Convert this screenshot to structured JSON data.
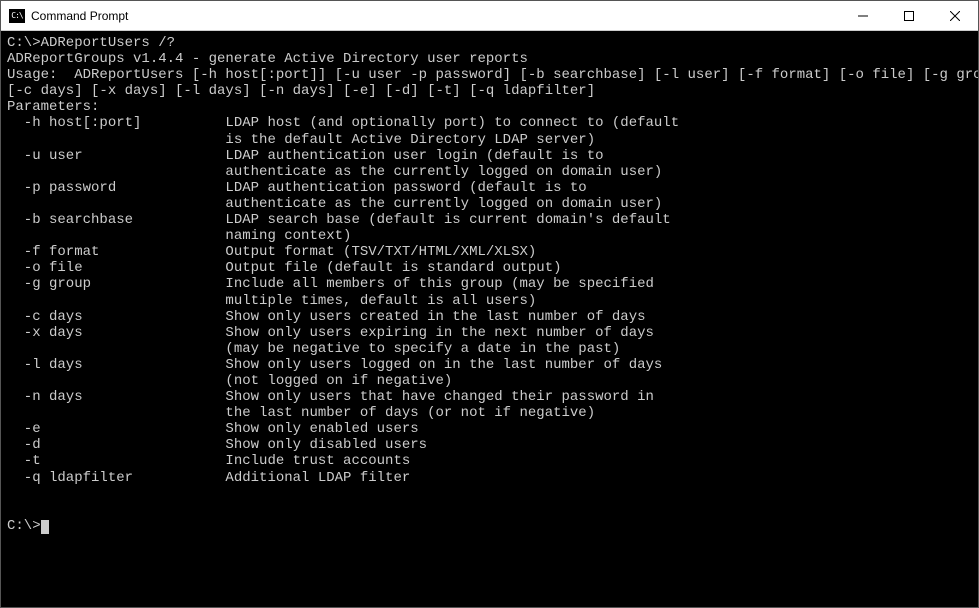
{
  "window": {
    "title": "Command Prompt",
    "icon_label": "C:\\"
  },
  "terminal": {
    "prompt": "C:\\>",
    "command": "ADReportUsers /?",
    "version_line": "ADReportGroups v1.4.4 - generate Active Directory user reports",
    "usage_lines": [
      "Usage:  ADReportUsers [-h host[:port]] [-u user -p password] [-b searchbase] [-l user] [-f format] [-o file] [-g group]",
      "[-c days] [-x days] [-l days] [-n days] [-e] [-d] [-t] [-q ldapfilter]"
    ],
    "parameters_header": "Parameters:",
    "parameters": [
      {
        "flag": "-h host[:port]",
        "desc": [
          "LDAP host (and optionally port) to connect to (default",
          "is the default Active Directory LDAP server)"
        ]
      },
      {
        "flag": "-u user",
        "desc": [
          "LDAP authentication user login (default is to",
          "authenticate as the currently logged on domain user)"
        ]
      },
      {
        "flag": "-p password",
        "desc": [
          "LDAP authentication password (default is to",
          "authenticate as the currently logged on domain user)"
        ]
      },
      {
        "flag": "-b searchbase",
        "desc": [
          "LDAP search base (default is current domain's default",
          "naming context)"
        ]
      },
      {
        "flag": "-f format",
        "desc": [
          "Output format (TSV/TXT/HTML/XML/XLSX)"
        ]
      },
      {
        "flag": "-o file",
        "desc": [
          "Output file (default is standard output)"
        ]
      },
      {
        "flag": "-g group",
        "desc": [
          "Include all members of this group (may be specified",
          "multiple times, default is all users)"
        ]
      },
      {
        "flag": "-c days",
        "desc": [
          "Show only users created in the last number of days"
        ]
      },
      {
        "flag": "-x days",
        "desc": [
          "Show only users expiring in the next number of days",
          "(may be negative to specify a date in the past)"
        ]
      },
      {
        "flag": "-l days",
        "desc": [
          "Show only users logged on in the last number of days",
          "(not logged on if negative)"
        ]
      },
      {
        "flag": "-n days",
        "desc": [
          "Show only users that have changed their password in",
          "the last number of days (or not if negative)"
        ]
      },
      {
        "flag": "-e",
        "desc": [
          "Show only enabled users"
        ]
      },
      {
        "flag": "-d",
        "desc": [
          "Show only disabled users"
        ]
      },
      {
        "flag": "-t",
        "desc": [
          "Include trust accounts"
        ]
      },
      {
        "flag": "-q ldapfilter",
        "desc": [
          "Additional LDAP filter"
        ]
      }
    ],
    "final_prompt": "C:\\>"
  }
}
